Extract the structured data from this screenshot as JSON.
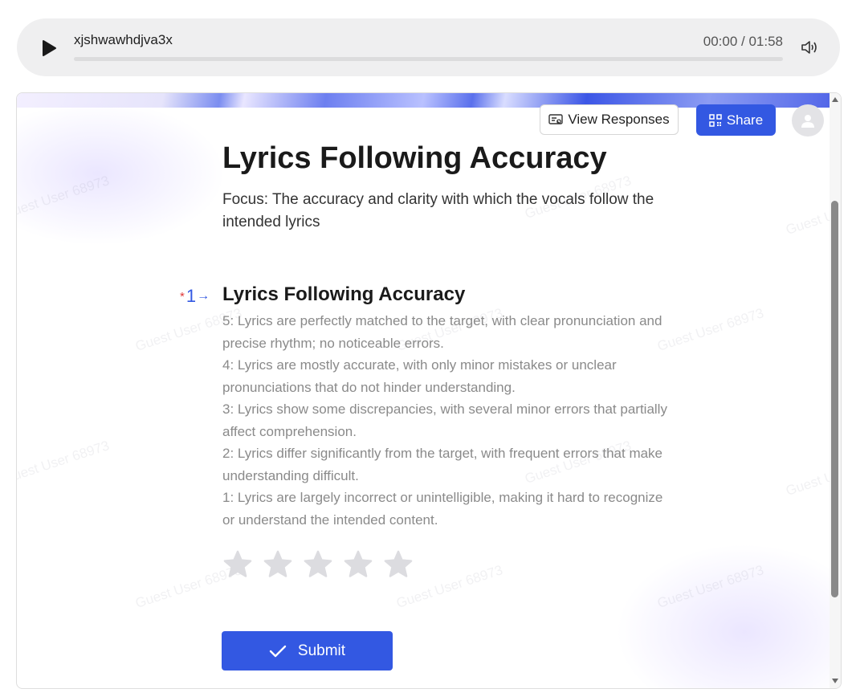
{
  "player": {
    "track_name": "xjshwawhdjva3x",
    "time": "00:00 / 01:58",
    "progress": 0
  },
  "header": {
    "view_responses_label": "View Responses",
    "share_label": "Share"
  },
  "form": {
    "title": "Lyrics Following Accuracy",
    "focus": "Focus: The accuracy and clarity with which the vocals follow the intended lyrics"
  },
  "question": {
    "required_mark": "*",
    "number": "1",
    "arrow": "→",
    "title": "Lyrics Following Accuracy",
    "description": [
      "5: Lyrics are perfectly matched to the target, with clear pronunciation and precise rhythm; no noticeable errors.",
      "4: Lyrics are mostly accurate, with only minor mistakes or unclear pronunciations that do not hinder understanding.",
      "3: Lyrics show some discrepancies, with several minor errors that partially affect comprehension.",
      "2: Lyrics differ significantly from the target, with frequent errors that make understanding difficult.",
      "1: Lyrics are largely incorrect or unintelligible, making it hard to recognize or understand the intended content."
    ],
    "rating_max": 5,
    "rating_value": 0
  },
  "submit_label": "Submit",
  "watermark": "Guest User 68973",
  "colors": {
    "accent": "#3358e2",
    "required": "#e03a3a",
    "star_empty": "#dcdce0"
  }
}
